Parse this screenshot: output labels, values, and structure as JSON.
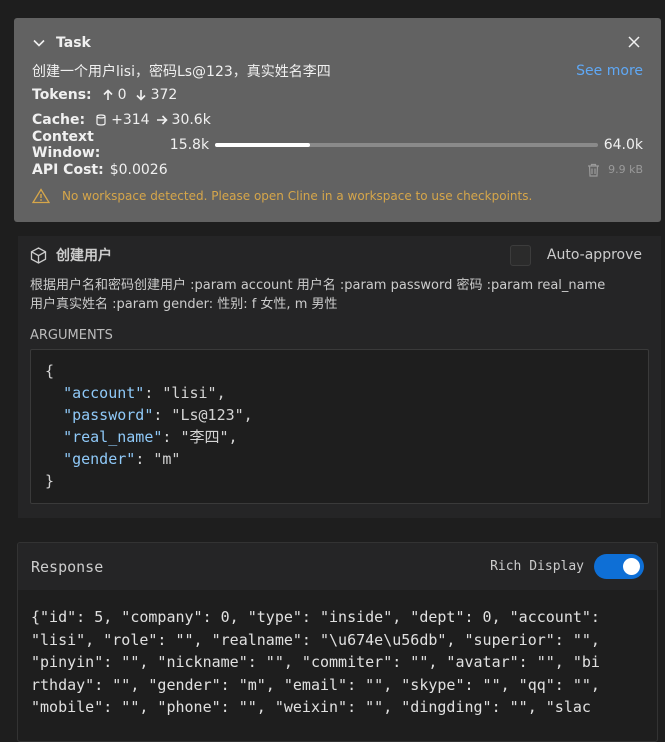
{
  "task": {
    "title": "Task",
    "text": "创建一个用户lisi，密码Ls@123，真实姓名李四",
    "see_more": "See more",
    "tokens_label": "Tokens:",
    "tokens_in": "0",
    "tokens_out": "372",
    "cache_label": "Cache:",
    "cache_write": "+314",
    "cache_read": "30.6k",
    "context_label": "Context Window:",
    "context_used": "15.8k",
    "context_max": "64.0k",
    "context_fraction": 0.247,
    "cost_label": "API Cost:",
    "cost_value": "$0.0026",
    "size": "9.9 kB",
    "warning": "No workspace detected. Please open Cline in a workspace to use checkpoints."
  },
  "tool": {
    "name": "创建用户",
    "auto_approve": "Auto-approve",
    "description_line1": "根据用户名和密码创建用户 :param account 用户名 :param password 密码 :param real_name",
    "description_line2": "用户真实姓名 :param gender: 性别: f 女性, m 男性",
    "args_label": "ARGUMENTS",
    "args": {
      "open": "{",
      "close": "}",
      "rows": [
        {
          "key": "\"account\"",
          "rest": ": \"lisi\","
        },
        {
          "key": "\"password\"",
          "rest": ": \"Ls@123\","
        },
        {
          "key": "\"real_name\"",
          "rest": ": \"李四\","
        },
        {
          "key": "\"gender\"",
          "rest": ": \"m\""
        }
      ]
    }
  },
  "response": {
    "title": "Response",
    "rich_display": "Rich Display",
    "rich_display_on": true,
    "lines": [
      "{\"id\": 5, \"company\": 0, \"type\": \"inside\", \"dept\": 0, \"account\":",
      "\"lisi\", \"role\": \"\", \"realname\": \"\\u674e\\u56db\", \"superior\": \"\",",
      "\"pinyin\": \"\", \"nickname\": \"\", \"commiter\": \"\", \"avatar\": \"\", \"bi",
      "rthday\": \"\", \"gender\": \"m\", \"email\": \"\", \"skype\": \"\", \"qq\": \"\",",
      "\"mobile\": \"\", \"phone\": \"\", \"weixin\": \"\", \"dingding\": \"\", \"slac"
    ]
  }
}
